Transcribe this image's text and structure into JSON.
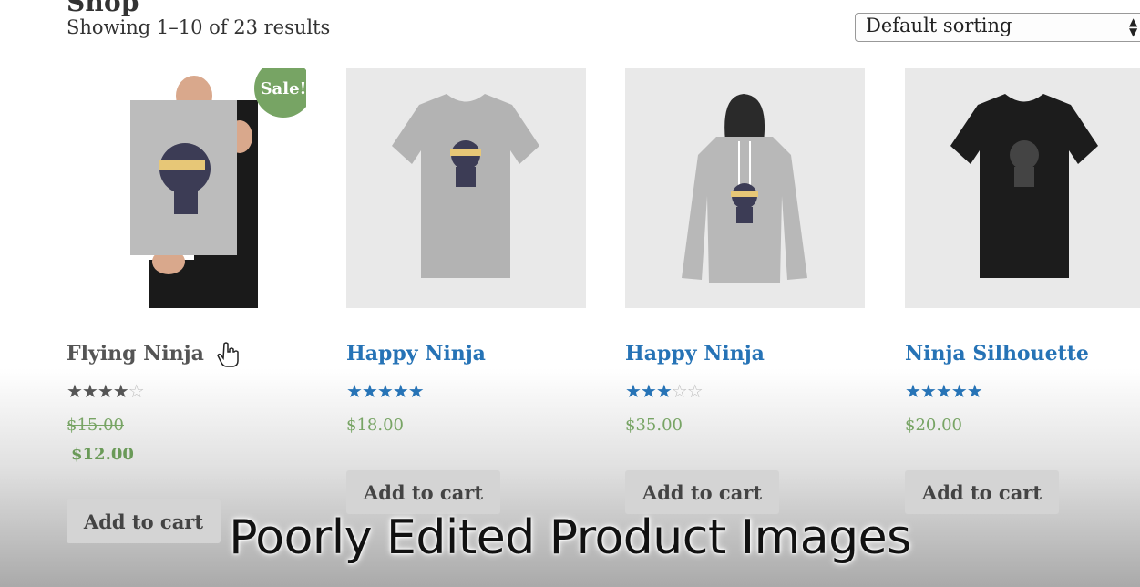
{
  "header": {
    "title": "Shop",
    "result_count": "Showing 1–10 of 23 results",
    "sorting": {
      "selected": "Default sorting"
    }
  },
  "products": [
    {
      "name": "Flying Ninja",
      "rating": 4,
      "price_old": "$15.00",
      "price": "$12.00",
      "sale_badge": "Sale!",
      "button": "Add to cart",
      "title_color": "#555555"
    },
    {
      "name": "Happy Ninja",
      "rating": 5,
      "price": "$18.00",
      "button": "Add to cart",
      "title_color": "#2673b6"
    },
    {
      "name": "Happy Ninja",
      "rating": 3,
      "price": "$35.00",
      "button": "Add to cart",
      "title_color": "#2673b6"
    },
    {
      "name": "Ninja Silhouette",
      "rating": 5,
      "price": "$20.00",
      "button": "Add to cart",
      "title_color": "#2673b6"
    }
  ],
  "colors": {
    "accent": "#77a464",
    "link": "#2673b6",
    "button_bg": "#d4d4d4",
    "star_filled_blue": "#2673b6",
    "star_filled_grey": "#555555"
  },
  "overlay": {
    "caption": "Poorly Edited Product Images"
  }
}
